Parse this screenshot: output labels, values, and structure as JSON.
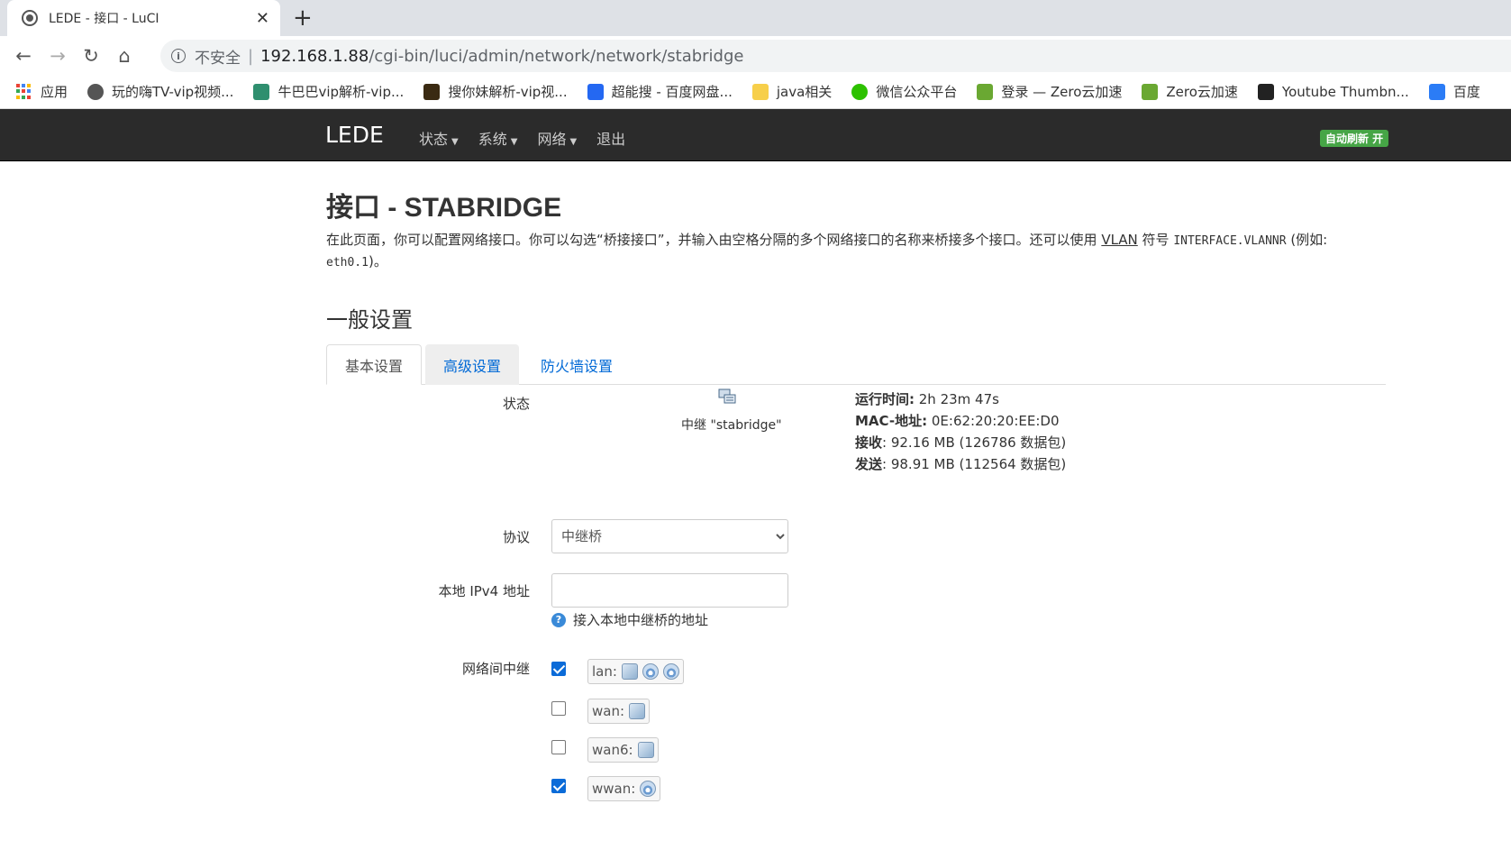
{
  "browser": {
    "tab_title": "LEDE - 接口 - LuCI",
    "new_tab": "+",
    "close": "✕",
    "insecure_label": "不安全",
    "url_host": "192.168.1.88",
    "url_path": "/cgi-bin/luci/admin/network/network/stabridge",
    "bookmarks": [
      {
        "label": "应用",
        "icon": "apps-icon"
      },
      {
        "label": "玩的嗨TV-vip视频...",
        "icon": "globe-icon",
        "color": "#555555"
      },
      {
        "label": "牛巴巴vip解析-vip...",
        "icon": "play-icon",
        "color": "#2f8f6f"
      },
      {
        "label": "搜你妹解析-vip视...",
        "icon": "crown-icon",
        "color": "#3a2a12"
      },
      {
        "label": "超能搜 - 百度网盘...",
        "icon": "cloud-icon",
        "color": "#2468f2"
      },
      {
        "label": "java相关",
        "icon": "folder-icon",
        "color": "#f7cf4a"
      },
      {
        "label": "微信公众平台",
        "icon": "wechat-icon",
        "color": "#2dc100"
      },
      {
        "label": "登录 — Zero云加速",
        "icon": "star-icon",
        "color": "#6aa832"
      },
      {
        "label": "Zero云加速",
        "icon": "star-icon",
        "color": "#6aa832"
      },
      {
        "label": "Youtube Thumbn...",
        "icon": "yt-icon",
        "color": "#222222"
      },
      {
        "label": "百度",
        "icon": "translate-icon",
        "color": "#2b7cf6"
      }
    ]
  },
  "luci": {
    "brand": "LEDE",
    "menu": [
      "状态",
      "系统",
      "网络",
      "退出"
    ],
    "autorefresh": "自动刷新 开"
  },
  "page": {
    "title": "接口 - STABRIDGE",
    "desc_1": "在此页面，你可以配置网络接口。你可以勾选“桥接接口”，并输入由空格分隔的多个网络接口的名称来桥接多个接口。还可以使用 ",
    "desc_vlan": "VLAN",
    "desc_2": " 符号 ",
    "desc_code1": "INTERFACE.VLANNR",
    "desc_3": " (例如: ",
    "desc_code2": "eth0.1",
    "desc_4": ")。",
    "section": "一般设置",
    "tabs": [
      "基本设置",
      "高级设置",
      "防火墙设置"
    ]
  },
  "form": {
    "status_label": "状态",
    "relay_name": "中继 \"stabridge\"",
    "uptime_label": "运行时间:",
    "uptime": " 2h 23m 47s",
    "mac_label": "MAC-地址:",
    "mac": " 0E:62:20:20:EE:D0",
    "rx_label": "接收",
    "rx": ": 92.16 MB (126786 数据包)",
    "tx_label": "发送",
    "tx": ": 98.91 MB (112564 数据包)",
    "proto_label": "协议",
    "proto_value": "中继桥",
    "ipv4_label": "本地 IPv4 地址",
    "ipv4_value": "",
    "ipv4_hint": "接入本地中继桥的地址",
    "relay_label": "网络间中继",
    "networks": [
      {
        "name": "lan:",
        "checked": true
      },
      {
        "name": "wan:",
        "checked": false
      },
      {
        "name": "wan6:",
        "checked": false
      },
      {
        "name": "wwan:",
        "checked": true
      }
    ]
  }
}
